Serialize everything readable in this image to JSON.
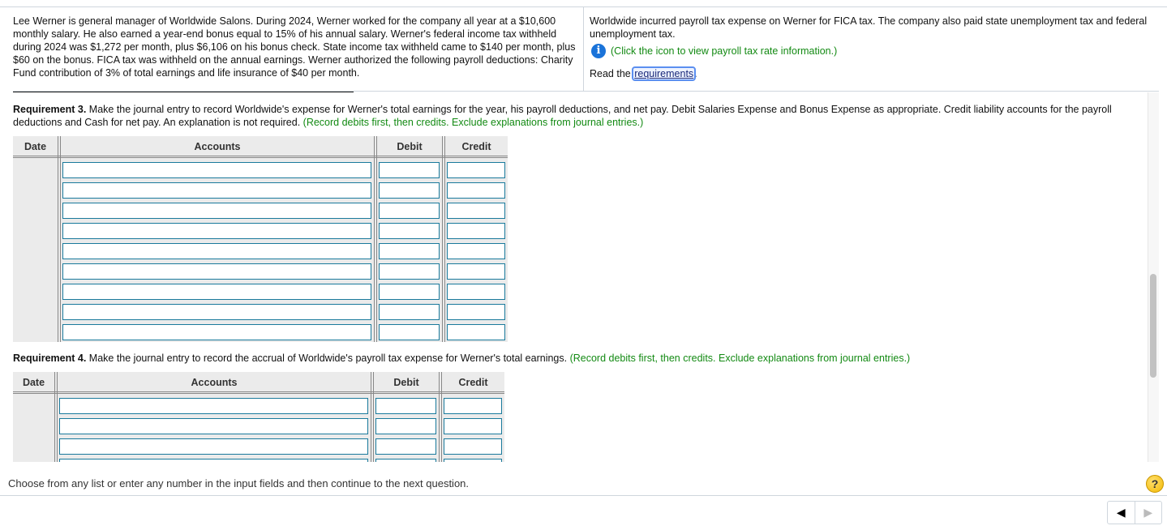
{
  "problem": {
    "left_text": "Lee Werner is general manager of Worldwide Salons. During 2024, Werner worked for the company all year at a $10,600 monthly salary. He also earned a year-end bonus equal to 15% of his annual salary. Werner's federal income tax withheld during 2024 was $1,272 per month, plus $6,106 on his bonus check. State income tax withheld came to $140 per month, plus $60 on the bonus. FICA tax was withheld on the annual earnings. Werner authorized the following payroll deductions: Charity Fund contribution of 3% of total earnings and life insurance of $40 per month.",
    "right_text": "Worldwide incurred payroll tax expense on Werner for FICA tax. The company also paid state unemployment tax and federal unemployment tax.",
    "info_icon": "info-icon",
    "info_text": "(Click the icon to view payroll tax rate information.)",
    "read_prefix": "Read the ",
    "requirements_link": "requirements",
    "read_suffix": "."
  },
  "requirement3": {
    "label": "Requirement 3.",
    "text": " Make the journal entry to record Worldwide's expense for Werner's total earnings for the year, his payroll deductions, and net pay. Debit Salaries Expense and Bonus Expense as appropriate. Credit liability accounts for the payroll deductions and Cash for net pay. An explanation is not required. ",
    "hint": "(Record debits first, then credits. Exclude explanations from journal entries.)",
    "columns": [
      "Date",
      "Accounts",
      "Debit",
      "Credit"
    ],
    "rows": 9
  },
  "requirement4": {
    "label": "Requirement 4.",
    "text": " Make the journal entry to record the accrual of Worldwide's payroll tax expense for Werner's total earnings. ",
    "hint": "(Record debits first, then credits. Exclude explanations from journal entries.)",
    "columns": [
      "Date",
      "Accounts",
      "Debit",
      "Credit"
    ],
    "rows_visible": 3
  },
  "footer": {
    "message": "Choose from any list or enter any number in the input fields and then continue to the next question.",
    "help_icon": "?",
    "prev_icon": "◀",
    "next_icon": "▶"
  },
  "colors": {
    "hint_green": "#138a13",
    "input_border": "#1a7a9c",
    "info_blue": "#1a73d9",
    "help_yellow": "#f2b800"
  }
}
